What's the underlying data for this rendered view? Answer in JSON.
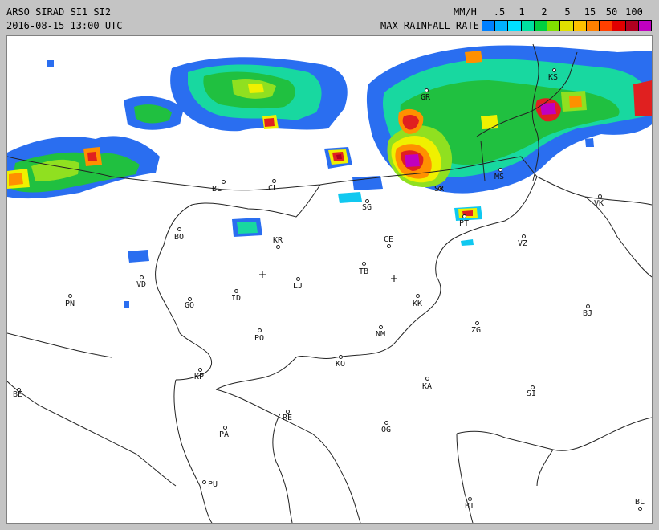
{
  "header": {
    "title": "ARSO SIRAD SI1 SI2",
    "timestamp": "2016-08-15 13:00 UTC",
    "unit": "MM/H",
    "legend_label": "MAX RAINFALL RATE",
    "scale_ticks": [
      ".5",
      "1",
      "2",
      "5",
      "15",
      "50",
      "100"
    ],
    "scale_colors": [
      "#0080ff",
      "#00b0ff",
      "#00e0ff",
      "#00e0a0",
      "#00d040",
      "#80e000",
      "#e0e000",
      "#ffc000",
      "#ff8000",
      "#ff4000",
      "#e00000",
      "#b00020",
      "#c000c0"
    ]
  },
  "cities": [
    "BL",
    "CL",
    "GR",
    "MS",
    "VK",
    "BO",
    "KR",
    "CE",
    "VZ",
    "VD",
    "LJ",
    "TB",
    "PN",
    "GO",
    "ID",
    "KK",
    "BJ",
    "PO",
    "NM",
    "ZG",
    "KO",
    "KP",
    "KA",
    "SI",
    "BE",
    "RE",
    "PA",
    "OG",
    "PU",
    "BI",
    "BL",
    "SG",
    "PT",
    "KS",
    "SR"
  ],
  "map": {
    "colors": {
      "blue": "#2a6ef0",
      "cyan": "#10c8f0",
      "teal": "#18d8a0",
      "green": "#20c040",
      "lime": "#90e020",
      "yellow": "#f0f000",
      "orange": "#ff9000",
      "red": "#e02020",
      "darkred": "#b00020",
      "magenta": "#c000c0"
    }
  }
}
